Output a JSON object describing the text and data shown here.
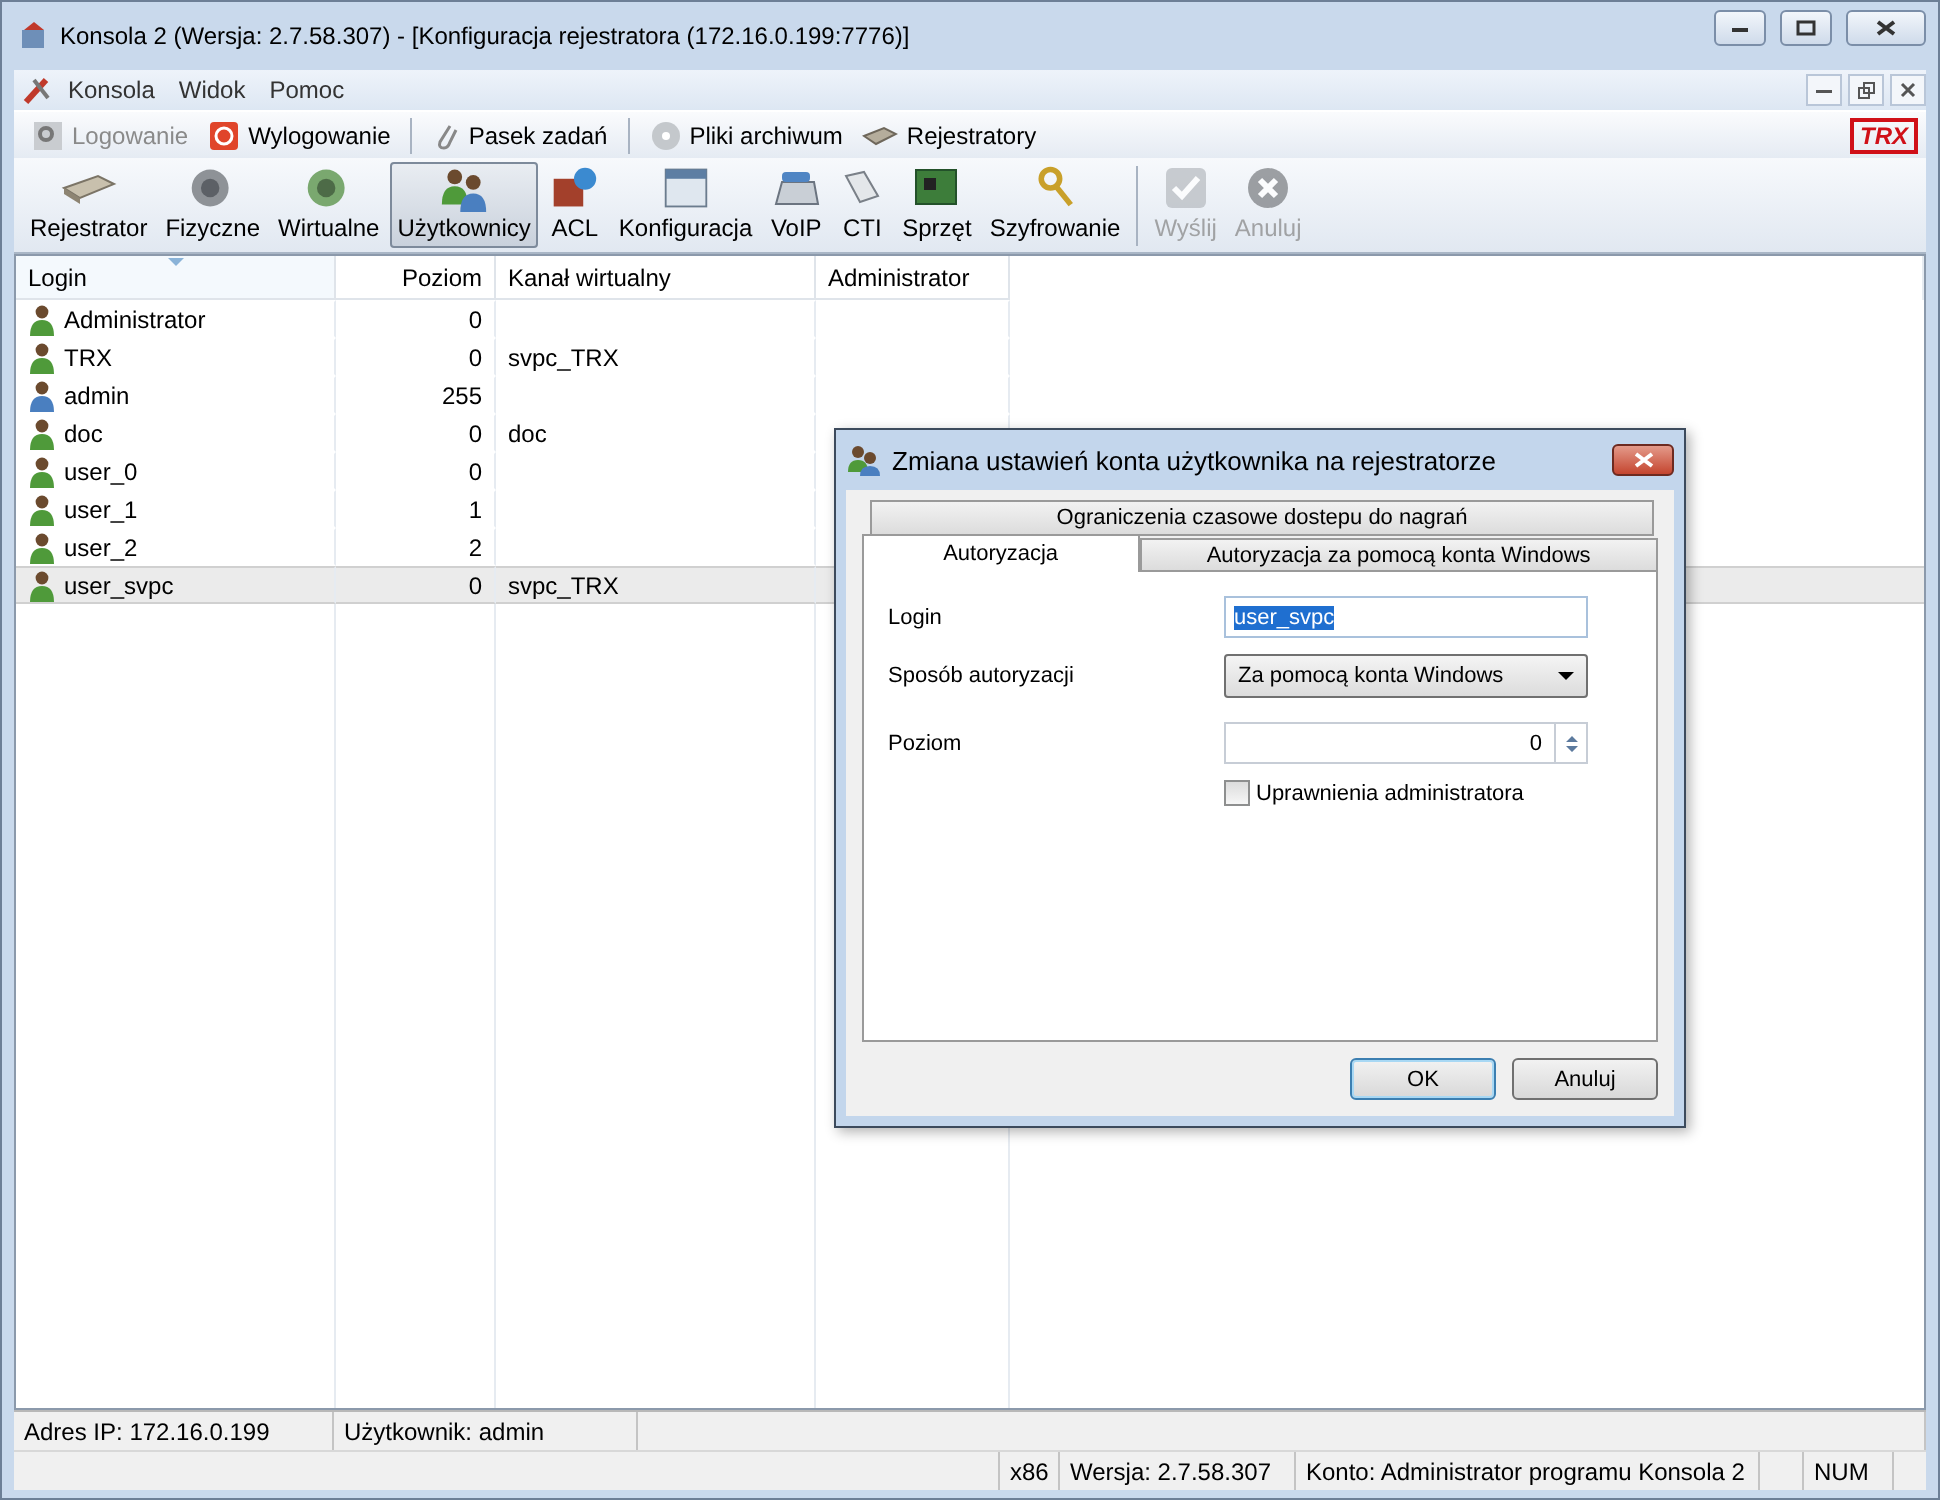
{
  "window": {
    "title": "Konsola 2 (Wersja:  2.7.58.307) - [Konfiguracja rejestratora (172.16.0.199:7776)]"
  },
  "menu": [
    "Konsola",
    "Widok",
    "Pomoc"
  ],
  "quickbar": {
    "groups": [
      {
        "items": [
          {
            "label": "Logowanie",
            "disabled": true
          },
          {
            "label": "Wylogowanie",
            "disabled": false
          }
        ]
      },
      {
        "items": [
          {
            "label": "Pasek zadań",
            "disabled": false
          }
        ]
      },
      {
        "items": [
          {
            "label": "Pliki archiwum",
            "disabled": false
          },
          {
            "label": "Rejestratory",
            "disabled": false
          }
        ]
      }
    ],
    "logo": "TRX"
  },
  "toolbar": {
    "groups": [
      {
        "items": [
          {
            "label": "Rejestrator",
            "selected": false,
            "disabled": false
          },
          {
            "label": "Fizyczne",
            "selected": false,
            "disabled": false
          },
          {
            "label": "Wirtualne",
            "selected": false,
            "disabled": false
          },
          {
            "label": "Użytkownicy",
            "selected": true,
            "disabled": false
          },
          {
            "label": "ACL",
            "selected": false,
            "disabled": false
          },
          {
            "label": "Konfiguracja",
            "selected": false,
            "disabled": false
          },
          {
            "label": "VoIP",
            "selected": false,
            "disabled": false
          },
          {
            "label": "CTI",
            "selected": false,
            "disabled": false
          },
          {
            "label": "Sprzęt",
            "selected": false,
            "disabled": false
          },
          {
            "label": "Szyfrowanie",
            "selected": false,
            "disabled": false
          }
        ]
      },
      {
        "items": [
          {
            "label": "Wyślij",
            "selected": false,
            "disabled": true
          },
          {
            "label": "Anuluj",
            "selected": false,
            "disabled": true
          }
        ]
      }
    ]
  },
  "table": {
    "columns": [
      {
        "label": "Login",
        "sorted": true
      },
      {
        "label": "Poziom",
        "sorted": false
      },
      {
        "label": "Kanał wirtualny",
        "sorted": false
      },
      {
        "label": "Administrator",
        "sorted": false
      }
    ],
    "rows": [
      {
        "login": "Administrator",
        "level": "0",
        "channel": "",
        "color": "#4f9a3a",
        "selected": false
      },
      {
        "login": "TRX",
        "level": "0",
        "channel": "svpc_TRX",
        "color": "#4f9a3a",
        "selected": false
      },
      {
        "login": "admin",
        "level": "255",
        "channel": "",
        "color": "#4a7fc0",
        "selected": false
      },
      {
        "login": "doc",
        "level": "0",
        "channel": "doc",
        "color": "#4f9a3a",
        "selected": false
      },
      {
        "login": "user_0",
        "level": "0",
        "channel": "",
        "color": "#4f9a3a",
        "selected": false
      },
      {
        "login": "user_1",
        "level": "1",
        "channel": "",
        "color": "#4f9a3a",
        "selected": false
      },
      {
        "login": "user_2",
        "level": "2",
        "channel": "",
        "color": "#4f9a3a",
        "selected": false
      },
      {
        "login": "user_svpc",
        "level": "0",
        "channel": "svpc_TRX",
        "color": "#4f9a3a",
        "selected": true
      }
    ]
  },
  "dialog": {
    "title": "Zmiana ustawień konta użytkownika na rejestratorze",
    "back_tabs": [
      {
        "label": "Ograniczenia czasowe dostepu do nagrań",
        "selected": false
      }
    ],
    "tabs": [
      {
        "label": "Autoryzacja",
        "selected": true
      },
      {
        "label": "Autoryzacja za pomocą konta Windows",
        "selected": false
      }
    ],
    "login": {
      "label": "Login",
      "value": "user_svpc"
    },
    "auth": {
      "label": "Sposób autoryzacji",
      "value": "Za pomocą konta Windows"
    },
    "level": {
      "label": "Poziom",
      "value": "0"
    },
    "admin": {
      "label": "Uprawnienia administratora",
      "checked": false
    },
    "buttons": [
      {
        "label": "OK",
        "default": true
      },
      {
        "label": "Anuluj",
        "default": false
      }
    ]
  },
  "status": {
    "top": [
      "Adres IP: 172.16.0.199",
      "Użytkownik: admin"
    ],
    "bottom": [
      "x86",
      "Wersja: 2.7.58.307",
      "Konto: Administrator programu Konsola 2",
      "NUM"
    ]
  }
}
